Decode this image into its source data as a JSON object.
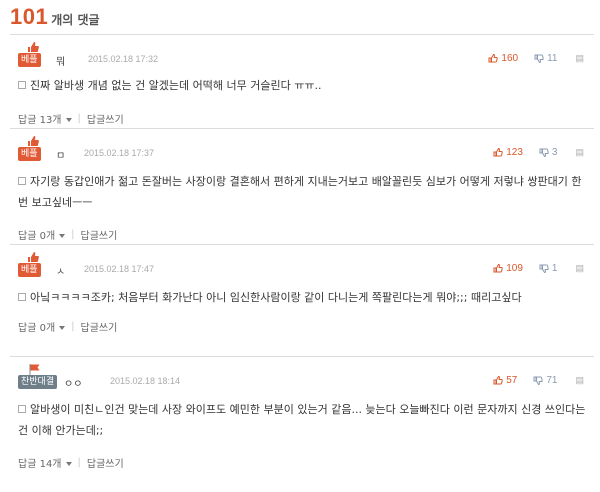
{
  "header": {
    "count": "101",
    "suffix": "개의 댓글"
  },
  "comments": [
    {
      "badge": "베플",
      "author": "뭐",
      "date": "2015.02.18 17:32",
      "likes": "160",
      "dislikes": "11",
      "text": "진짜 알바생 개념 없는 건 알겠는데 어떡해 너무 거슬린다 ㅠㅠ..",
      "replies": "답글 13개",
      "reply_write": "답글쓰기"
    },
    {
      "badge": "베플",
      "author": "ㅁ",
      "date": "2015.02.18 17:37",
      "likes": "123",
      "dislikes": "3",
      "text": "자기랑 동갑인애가 젊고 돈잘버는 사장이랑 결혼해서 편하게 지내는거보고 배알꼴린듯 심보가 어떻게 저렇냐 쌍판대기 한 번 보고싶네ㅡㅡ",
      "replies": "답글 0개",
      "reply_write": "답글쓰기"
    },
    {
      "badge": "베플",
      "author": "ㅅ",
      "date": "2015.02.18 17:47",
      "likes": "109",
      "dislikes": "1",
      "text": "아닠ㅋㅋㅋㅋ조카; 처음부터 화가난다 아니 임신한사람이랑 같이 다니는게 쪽팔린다는게 뭐야;;; 때리고싶다",
      "replies": "답글 0개",
      "reply_write": "답글쓰기"
    },
    {
      "badge": "찬반대결",
      "author": "ㅇㅇ",
      "date": "2015.02.18 18:14",
      "likes": "57",
      "dislikes": "71",
      "text": "알바생이 미친ㄴ인건 맞는데 사장 와이프도 예민한 부분이 있는거 같음... 늦는다 오늘빠진다 이런 문자까지 신경 쓰인다는건 이해 안가는데;;",
      "replies": "답글 14개",
      "reply_write": "답글쓰기"
    }
  ],
  "colors": {
    "accent": "#d9572b",
    "best_badge": "#e05a35",
    "vs_badge": "#6f7f8a",
    "dislike": "#8a9bb0"
  },
  "icons": [
    "thumbs-up-icon",
    "thumbs-down-icon",
    "report-icon",
    "document-icon",
    "caret-down-icon",
    "flag-icon"
  ]
}
